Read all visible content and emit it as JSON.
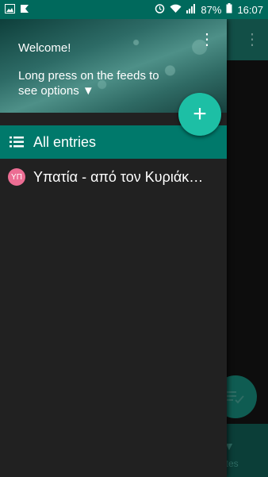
{
  "status_bar": {
    "battery": "87%",
    "time": "16:07"
  },
  "colors": {
    "accent": "#1dbfa5",
    "primary": "#00796b",
    "status_bar": "#00695c",
    "avatar": "#ec6d93",
    "drawer_bg": "#212121"
  },
  "drawer": {
    "header": {
      "welcome": "Welcome!",
      "hint": "Long press on the feeds to see options ▼",
      "menu_icon": "overflow-menu-icon"
    },
    "add_icon": "+",
    "all_entries": {
      "label": "All entries",
      "icon": "list-icon"
    },
    "feeds": [
      {
        "avatar": "ΥΠ",
        "title": "Υπατία - από τον Κυριάκ…"
      }
    ]
  },
  "background": {
    "bottom_label": "ites"
  }
}
